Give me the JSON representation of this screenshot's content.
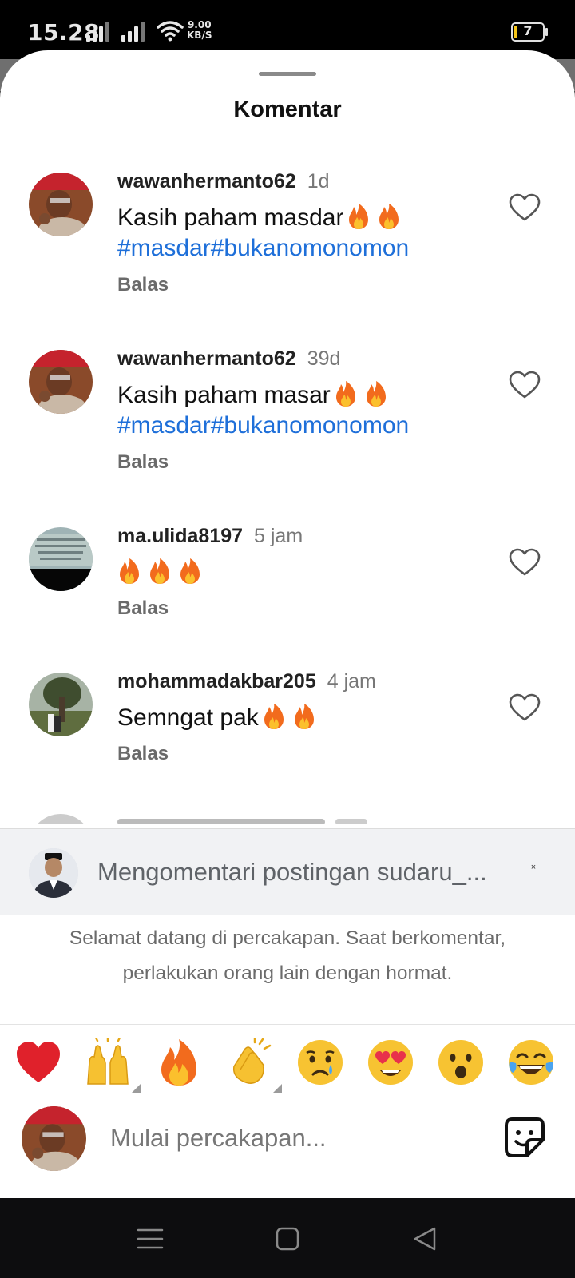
{
  "status_bar": {
    "time": "15.28",
    "net_speed_value": "9.00",
    "net_speed_unit": "KB/S",
    "battery": "7"
  },
  "sheet": {
    "title": "Komentar"
  },
  "comments": [
    {
      "username": "wawanhermanto62",
      "time": "1d",
      "text": "Kasih paham masdar",
      "emoji_count": 2,
      "hashtags": "#masdar#bukanomonomon",
      "reply_label": "Balas"
    },
    {
      "username": "wawanhermanto62",
      "time": "39d",
      "text": "Kasih paham masar",
      "emoji_count": 2,
      "hashtags": "#masdar#bukanomonomon",
      "reply_label": "Balas"
    },
    {
      "username": "ma.ulida8197",
      "time": "5 jam",
      "text": "",
      "emoji_count": 3,
      "hashtags": "",
      "reply_label": "Balas"
    },
    {
      "username": "mohammadakbar205",
      "time": "4 jam",
      "text": "Semngat pak",
      "emoji_count": 2,
      "hashtags": "",
      "reply_label": "Balas"
    }
  ],
  "replying_bar": {
    "text": "Mengomentari postingan sudaru_...",
    "close_label": "×"
  },
  "welcome_message": {
    "line1": "Selamat datang di percakapan. Saat berkomentar,",
    "line2": "perlakukan orang lain dengan hormat."
  },
  "quick_emojis": [
    "❤️",
    "🙌",
    "🔥",
    "👏",
    "😢",
    "😍",
    "😮",
    "😂"
  ],
  "composer": {
    "placeholder": "Mulai percakapan..."
  },
  "icons": {
    "heart": "heart-outline-icon",
    "sticker": "sticker-icon",
    "nav": [
      "menu-icon",
      "home-square-icon",
      "back-triangle-icon"
    ]
  },
  "colors": {
    "hashtag": "#1e6fd9",
    "background": "#ffffff",
    "replying_bar": "#f1f2f4"
  }
}
